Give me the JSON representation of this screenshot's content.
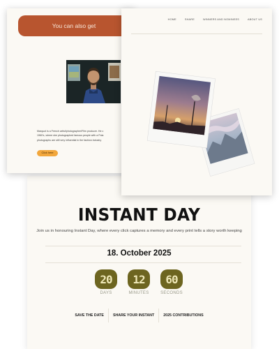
{
  "back_card": {
    "banner_text": "You can also get",
    "bio": "Marquot is a French artist/photographer/Film producer. He c\n1960's, where she photographed famous people with a Pola\nphotographs are still very influential in the fashion industry",
    "button_label": "Click here"
  },
  "front_card": {
    "nav": [
      "HOME",
      "SHARE",
      "WINNERS AND NOMINEES",
      "ABOUT US"
    ]
  },
  "main_card": {
    "title": "INSTANT DAY",
    "subtitle": "Join us in honouring Instant Day, where every click captures a memory and every print tells a story worth keeping",
    "date": "18. October 2025",
    "countdown": [
      {
        "value": "20",
        "unit": "DAYS"
      },
      {
        "value": "12",
        "unit": "MINUTES"
      },
      {
        "value": "60",
        "unit": "SECONDS"
      }
    ],
    "links": [
      "SAVE THE DATE",
      "SHARE YOUR INSTANT",
      "2025 CONTRIBUTIONS"
    ]
  },
  "colors": {
    "banner": "#b8552f",
    "button": "#f2a73c",
    "countdown_pill": "#6d6520",
    "card_bg": "#fbf9f4"
  }
}
